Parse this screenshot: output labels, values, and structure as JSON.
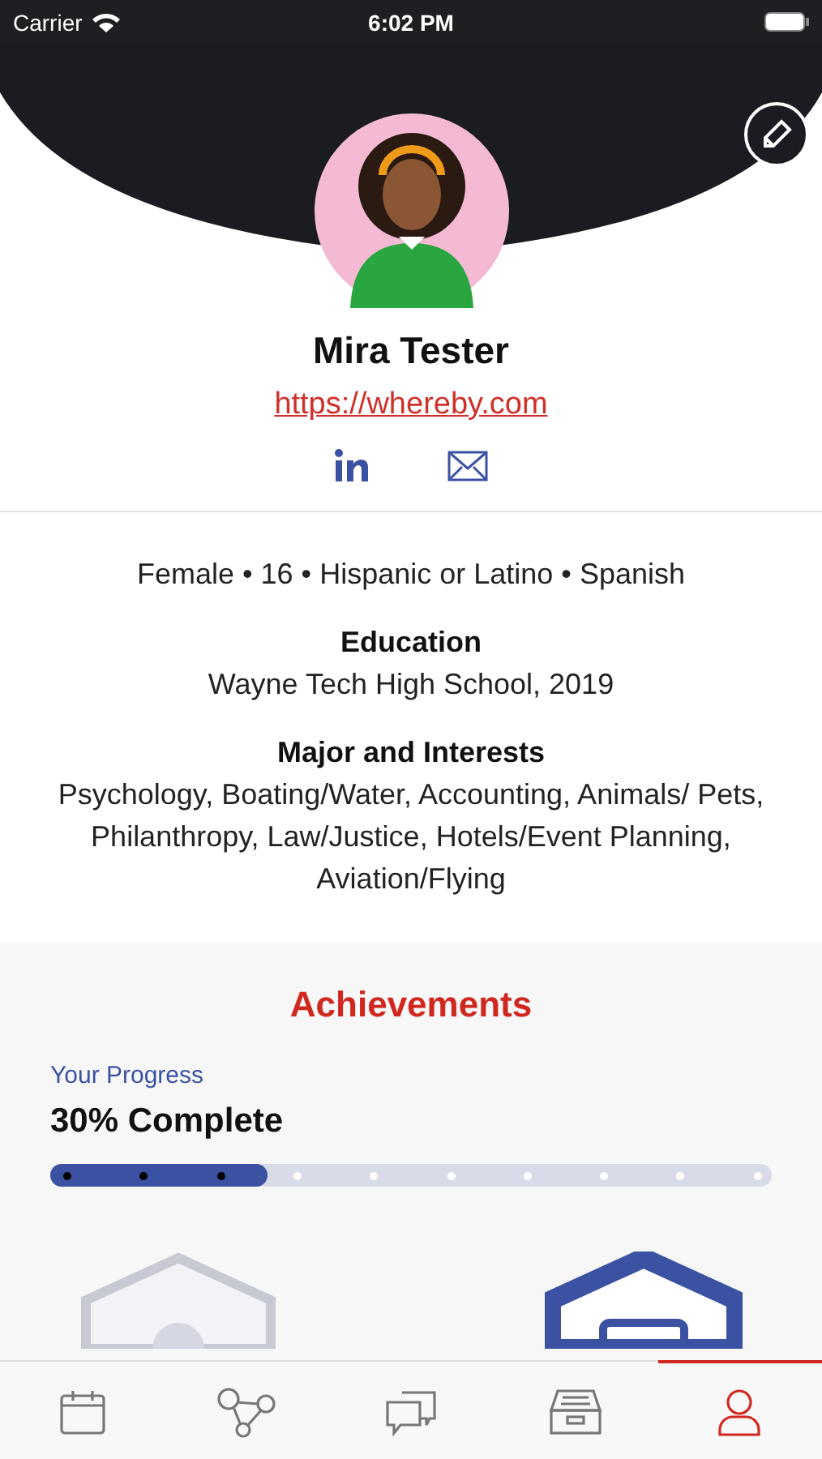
{
  "status_bar": {
    "carrier": "Carrier",
    "time": "6:02 PM"
  },
  "profile": {
    "name": "Mira Tester",
    "website": "https://whereby.com"
  },
  "details": {
    "demographics": "Female • 16 • Hispanic or Latino • Spanish",
    "education_heading": "Education",
    "education": "Wayne Tech High School, 2019",
    "interests_heading": "Major and Interests",
    "interests": "Psychology, Boating/Water, Accounting, Animals/ Pets, Philanthropy, Law/Justice, Hotels/Event Planning, Aviation/Flying"
  },
  "achievements": {
    "title": "Achievements",
    "progress_label": "Your Progress",
    "progress_text": "30% Complete",
    "level": 0.3,
    "badges": [
      {
        "earned": false
      },
      {
        "earned": true
      }
    ]
  },
  "tabs": [
    {
      "kind": "calendar",
      "selected": false
    },
    {
      "kind": "network",
      "selected": false
    },
    {
      "kind": "chat",
      "selected": false
    },
    {
      "kind": "archive",
      "selected": false
    },
    {
      "kind": "profile",
      "selected": true
    }
  ]
}
